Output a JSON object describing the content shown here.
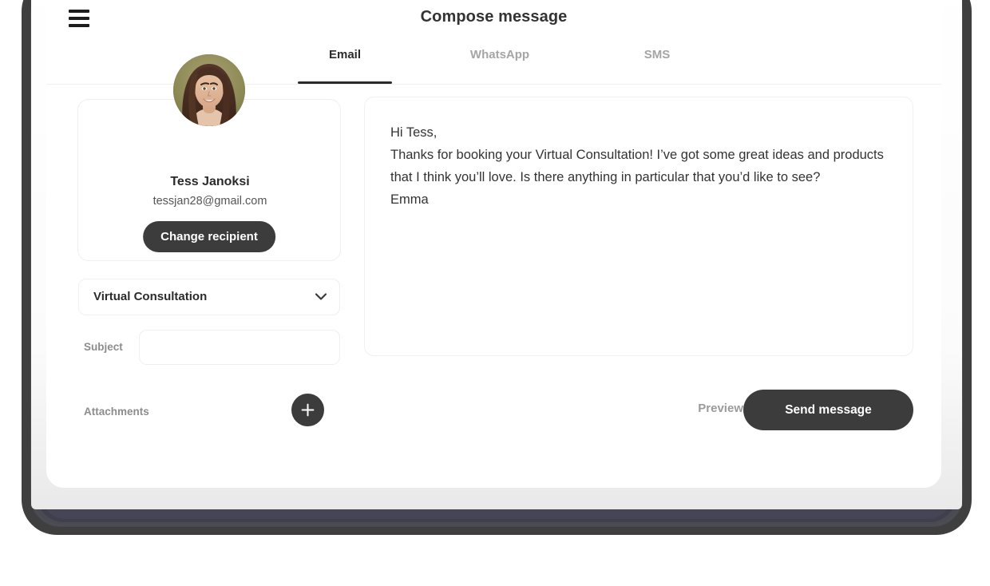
{
  "header": {
    "title": "Compose message",
    "menu_icon": "hamburger-menu-icon"
  },
  "tabs": [
    {
      "label": "Email",
      "active": true
    },
    {
      "label": "WhatsApp",
      "active": false
    },
    {
      "label": "SMS",
      "active": false
    }
  ],
  "recipient": {
    "name": "Tess Janoksi",
    "email": "tessjan28@gmail.com",
    "change_button_label": "Change recipient",
    "avatar_alt": "avatar-photo"
  },
  "service_select": {
    "value": "Virtual Consultation",
    "icon": "chevron-down-icon"
  },
  "subject": {
    "label": "Subject",
    "value": "",
    "placeholder": ""
  },
  "attachments": {
    "label": "Attachments",
    "add_icon": "plus-icon"
  },
  "message": {
    "body": "Hi Tess,\nThanks for booking your Virtual Consultation! I’ve got some great ideas and products that I think you’ll love. Is there anything in particular that you’d like to see?\nEmma",
    "placeholder": ""
  },
  "footer": {
    "preview_label": "Preview",
    "send_label": "Send message"
  },
  "colors": {
    "accent_dark": "#3c3c3c",
    "text_primary": "#2b2b2b",
    "text_muted": "#9b9b9b",
    "tab_active": "#2b2b2b",
    "tab_inactive": "#a5a5a5",
    "device_bezel": "#3f3f3f",
    "device_navy": "#3f3f4e"
  }
}
